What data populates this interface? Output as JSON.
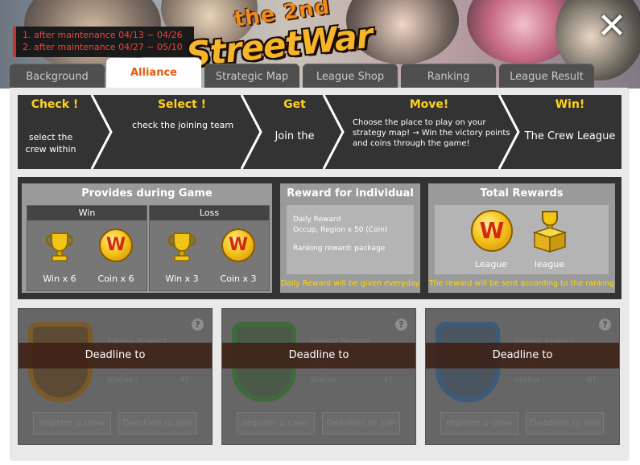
{
  "header": {
    "maintenance_line1": "1. after maintenance 04/13 ~ 04/26",
    "maintenance_line2": "2. after maintenance 04/27 ~ 05/10",
    "title_small": "the 2nd",
    "title_big": "StreetWar",
    "close_glyph": "✕"
  },
  "tabs": [
    {
      "label": "Background",
      "active": false
    },
    {
      "label": "Alliance",
      "active": true
    },
    {
      "label": "Strategic Map",
      "active": false
    },
    {
      "label": "League Shop",
      "active": false
    },
    {
      "label": "Ranking",
      "active": false
    },
    {
      "label": "League Result",
      "active": false
    }
  ],
  "steps": [
    {
      "title": "Check !",
      "desc": "select the crew within"
    },
    {
      "title": "Select !",
      "desc": "check the joining team"
    },
    {
      "title": "Get",
      "desc": "Join the"
    },
    {
      "title": "Move!",
      "desc": "Choose the place to play on your strategy map! → Win the victory points and coins through the game!"
    },
    {
      "title": "Win!",
      "desc": "The Crew League"
    }
  ],
  "provides": {
    "title": "Provides during Game",
    "win": {
      "header": "Win",
      "trophy_label": "Win x 6",
      "coin_label": "Coin x 6"
    },
    "loss": {
      "header": "Loss",
      "trophy_label": "Win x 3",
      "coin_label": "Coin x 3"
    },
    "coin_glyph": "W"
  },
  "individual": {
    "title": "Reward for individual",
    "line1": "Daily Reward",
    "line2": "Occup, Region x 50 (Coin)",
    "line3": "Ranking reward: package",
    "note": "Daily Reward will be given everyday"
  },
  "total": {
    "title": "Total Rewards",
    "coin_label": "League",
    "box_label": "league",
    "note": "The reward will be sent according to the ranking"
  },
  "cards": [
    {
      "band": "Deadline to",
      "ghost1": "Joining Reward",
      "ghost2": "Support",
      "ghost3": "Status :",
      "value": "4T",
      "btn_register": "register a crew",
      "btn_deadline": "Deadline to join",
      "emblem_color": "#7a5a2a"
    },
    {
      "band": "Deadline to",
      "ghost1": "Joining Reward",
      "ghost2": "Support",
      "ghost3": "Status :",
      "value": "4T",
      "btn_register": "register a crew",
      "btn_deadline": "Deadline to join",
      "emblem_color": "#3f6a3c"
    },
    {
      "band": "Deadline to",
      "ghost1": "Joining Reward",
      "ghost2": "Support",
      "ghost3": "Status :",
      "value": "0T",
      "btn_register": "register a crew",
      "btn_deadline": "Deadline to join",
      "emblem_color": "#3c5a7a"
    }
  ],
  "colors": {
    "accent_orange": "#e55b0b",
    "step_title_yellow": "#ffd21a",
    "panel_dark": "#333333"
  }
}
